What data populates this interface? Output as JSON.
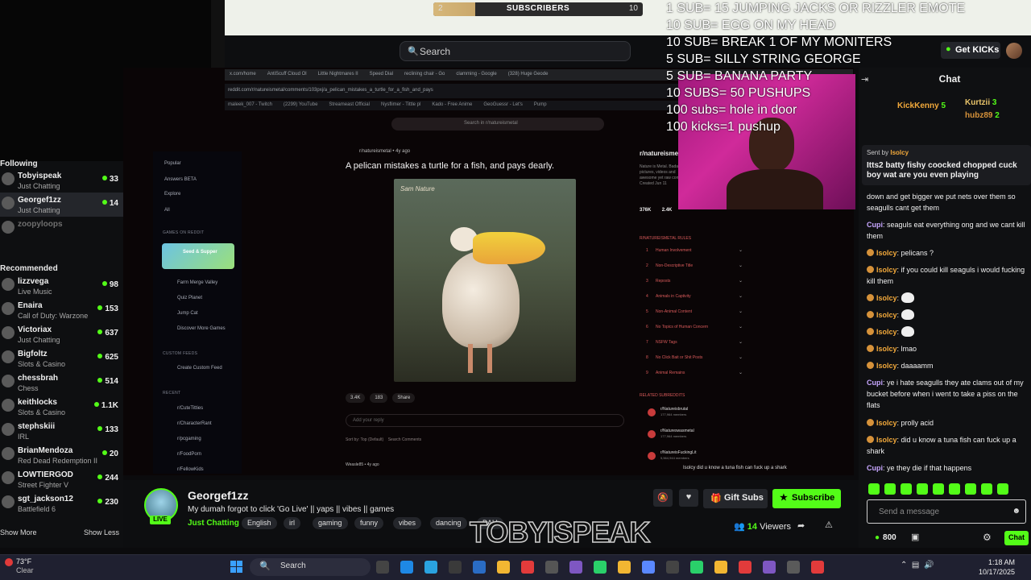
{
  "overlay": {
    "subscribers_label": "SUBSCRIBERS",
    "sub_current": "2",
    "sub_goal": "10",
    "sub_progress": 0.2,
    "goals": [
      "1 SUB= 15 JUMPING JACKS OR RIZZLER EMOTE",
      "10 SUB= EGG ON MY HEAD",
      "10 SUB= BREAK 1 OF MY MONITERS",
      "5 SUB= SILLY STRING GEORGE",
      "5 SUB= BANANA PARTY",
      "10 SUBS= 50 PUSHUPS",
      "100 subs= hole in door",
      "100 kicks=1 pushup"
    ],
    "watermark": "TOBYISPEAK"
  },
  "topnav": {
    "search_placeholder": "Search",
    "get_kicks": "Get KICKs"
  },
  "sidebar": {
    "following_title": "Following",
    "following": [
      {
        "name": "Tobyispeak",
        "category": "Just Chatting",
        "viewers": "33"
      },
      {
        "name": "Georgef1zz",
        "category": "Just Chatting",
        "viewers": "14"
      },
      {
        "name": "zoopyloops",
        "category": "",
        "viewers": ""
      }
    ],
    "recommended_title": "Recommended",
    "recommended": [
      {
        "name": "lizzvega",
        "category": "Live Music",
        "viewers": "98"
      },
      {
        "name": "Enaira",
        "category": "Call of Duty: Warzone",
        "viewers": "153"
      },
      {
        "name": "Victoriax",
        "category": "Just Chatting",
        "viewers": "637"
      },
      {
        "name": "Bigfoltz",
        "category": "Slots & Casino",
        "viewers": "625"
      },
      {
        "name": "chessbrah",
        "category": "Chess",
        "viewers": "514"
      },
      {
        "name": "keithlocks",
        "category": "Slots & Casino",
        "viewers": "1.1K"
      },
      {
        "name": "stephskiii",
        "category": "IRL",
        "viewers": "133"
      },
      {
        "name": "BrianMendoza",
        "category": "Red Dead Redemption II",
        "viewers": "20"
      },
      {
        "name": "LOWTIERGOD",
        "category": "Street Fighter V",
        "viewers": "244"
      },
      {
        "name": "sgt_jackson12",
        "category": "Battlefield 6",
        "viewers": "230"
      }
    ],
    "show_more": "Show More",
    "show_less": "Show Less"
  },
  "reddit": {
    "tabs": [
      "x.com/home",
      "AntiScuff Cloud Ol",
      "Little Nightmares II",
      "Speed Dial",
      "reclining chair - Go",
      "clamming - Google",
      "(328) Huge Geode"
    ],
    "url": "reddit.com/r/natureismetal/comments/103pxj/a_pelican_mistakes_a_turtle_for_a_fish_and_pays",
    "bookmarks": [
      "maleek_007 - Twitch",
      "(2299) YouTube",
      "Streameast Official",
      "Nysflimer - Tittle pl",
      "Kado - Free Anime",
      "GeoGuessr - Let's",
      "Pump"
    ],
    "search_text": "Search in r/natureismetal",
    "left_nav": [
      "Popular",
      "Answers BETA",
      "Explore",
      "All"
    ],
    "games_header": "GAMES ON REDDIT",
    "games_card": "Seed & Supper",
    "games": [
      "Farm Merge Valley",
      "Quiz Planet",
      "Jump Cat",
      "Discover More Games"
    ],
    "custom_header": "CUSTOM FEEDS",
    "create_feed": "Create Custom Feed",
    "recent_header": "RECENT",
    "recent": [
      "r/CuteTitties",
      "r/CharacterRant",
      "r/pcgaming",
      "r/FoodPorn",
      "r/FellowKids"
    ],
    "post_user": "r/natureismetal • 4y ago",
    "post_title": "A pelican mistakes a turtle for a fish, and pays dearly.",
    "image_credit": "Sam Nature",
    "votes": "3.4K",
    "comments": "183",
    "share": "Share",
    "reply_placeholder": "Add your reply",
    "sort": "Sort by: Top (Default)",
    "search_comments": "Search Comments",
    "comment_user": "Weasle85 • 4y ago",
    "sub_title": "r/natureismetal",
    "sub_desc": "Nature is Metal. Badass pictures, videos and awesome yet raw content. Created Jun 11",
    "members": "376K",
    "online": "2.4K",
    "rules_header": "R/NATUREISMETAL RULES",
    "rules": [
      "Human Involvement",
      "Non-Descriptive Title",
      "Reposts",
      "Animals in Captivity",
      "Non-Animal Content",
      "No Topics of Human Concern",
      "NSFW Tags",
      "No Click Bait or Shit Posts",
      "Animal Remains"
    ],
    "related_header": "RELATED SUBREDDITS",
    "related": [
      {
        "name": "r/Natureisbrutal",
        "members": "177,964 members"
      },
      {
        "name": "r/Natureswasmetal",
        "members": "177,964 members"
      },
      {
        "name": "r/NatureisFuckingLit",
        "members": "5,564,944 members"
      }
    ],
    "toast": "Isolcy did u know a tuna fish can fuck up a shark"
  },
  "chat": {
    "title": "Chat",
    "top_gifters": [
      {
        "name": "KickKenny",
        "count": "5"
      },
      {
        "name": "Kurtzii",
        "count": "3"
      },
      {
        "name": "hubz89",
        "count": "2"
      }
    ],
    "pinned_by_label": "Sent by",
    "pinned_by": "Isolcy",
    "pinned_msg": "Itts2 batty fishy coocked chopped cuck boy wat are you even playing",
    "messages": [
      {
        "user": "",
        "text": "down and get bigger we put nets over them so seagulls cant get them"
      },
      {
        "user": "Cupi",
        "text": "seaguls eat everything ong and we cant kill them"
      },
      {
        "user": "Isolcy",
        "text": "pelicans ?"
      },
      {
        "user": "Isolcy",
        "text": "if you could kill seaguls i would fucking kill them"
      },
      {
        "user": "Isolcy",
        "text": ""
      },
      {
        "user": "Isolcy",
        "text": ""
      },
      {
        "user": "Isolcy",
        "text": ""
      },
      {
        "user": "Isolcy",
        "text": "lmao"
      },
      {
        "user": "Isolcy",
        "text": "daaaamm"
      },
      {
        "user": "Cupi",
        "text": "ye i hate seagulls they ate clams out of my bucket before when i went to take a piss on the flats"
      },
      {
        "user": "Isolcy",
        "text": "prolly acid"
      },
      {
        "user": "Isolcy",
        "text": "did u know a tuna fish can fuck up a shark"
      },
      {
        "user": "Cupi",
        "text": "ye they die if that happens"
      }
    ],
    "input_placeholder": "Send a message",
    "kicks": "800",
    "send": "Chat"
  },
  "stream": {
    "channel": "Georgef1zz",
    "title": "My dumah forgot to click 'Go Live' || yaps || vibes || games",
    "category": "Just Chatting",
    "tags": [
      "English",
      "irl",
      "gaming",
      "funny",
      "vibes",
      "dancing",
      "BAU"
    ],
    "live": "LIVE",
    "viewers_count": "14",
    "viewers_label": "Viewers",
    "gift_subs": "Gift Subs",
    "subscribe": "Subscribe"
  },
  "taskbar": {
    "temp": "73°F",
    "condition": "Clear",
    "search": "Search",
    "time": "1:18 AM",
    "date": "10/17/2025"
  },
  "colors": {
    "kick_green": "#53fc18",
    "facecam_pink": "#d02a9a",
    "reddit_rule_red": "#d95a5a"
  }
}
